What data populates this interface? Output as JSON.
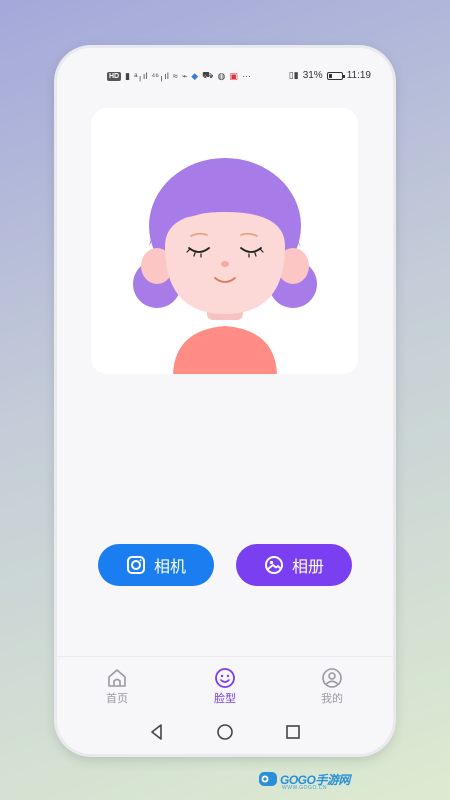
{
  "status_bar": {
    "left_glyphs": [
      "HD",
      "▮",
      "ᵃ╷ıl",
      "⁴⁶╷ıl",
      "≈",
      "⌁",
      "◆",
      "⛟",
      "◍",
      "▣",
      "···"
    ],
    "vibrate": "▯▮",
    "battery_percent_text": "31%",
    "battery_level": 0.31,
    "time": "11:19"
  },
  "actions": {
    "camera_label": "相机",
    "album_label": "相册"
  },
  "tabs": [
    {
      "label": "首页",
      "icon": "home-icon",
      "active": false
    },
    {
      "label": "脸型",
      "icon": "smiley-face-icon",
      "active": true
    },
    {
      "label": "我的",
      "icon": "profile-icon",
      "active": false
    }
  ],
  "nav": {
    "back_icon": "back-triangle-icon",
    "home_icon": "home-circle-icon",
    "recent_icon": "recent-apps-square-icon"
  },
  "watermark": {
    "text": "GOGO手游网",
    "subtext": "WWW.GOGO.CN"
  },
  "colors": {
    "camera_button": "#1a7df0",
    "album_button": "#7a3ff0",
    "active_tab": "#7a3ff0",
    "hair": "#a87ce8",
    "skin": "#fcd8d6",
    "shirt": "#ff8d86"
  }
}
